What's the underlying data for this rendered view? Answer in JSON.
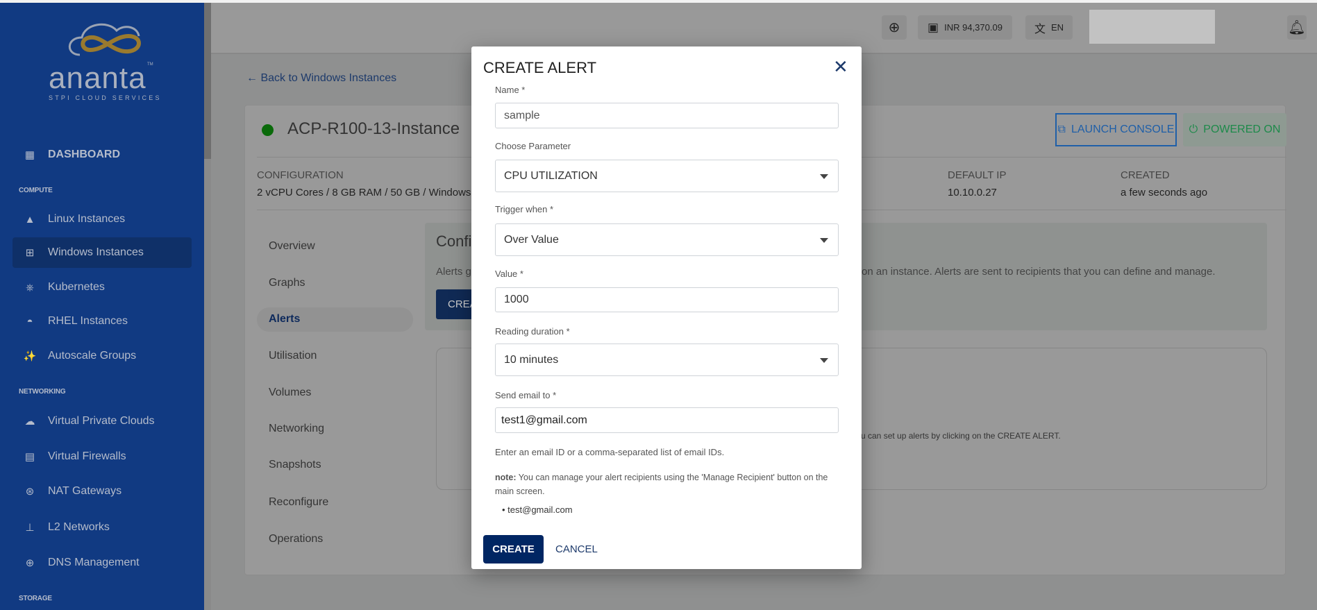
{
  "brand": {
    "name": "ananta",
    "tagline": "STPI CLOUD SERVICES",
    "tm": "TM",
    "colors": {
      "sidebar": "#113a82",
      "accent": "#002663",
      "gold": "#b8860b"
    }
  },
  "sidebar": {
    "dashboard": "DASHBOARD",
    "sections": {
      "compute": "COMPUTE",
      "networking": "NETWORKING",
      "storage": "STORAGE"
    },
    "items": [
      {
        "label": "Linux Instances",
        "icon": "linux-icon"
      },
      {
        "label": "Windows Instances",
        "icon": "windows-icon",
        "active": true
      },
      {
        "label": "Kubernetes",
        "icon": "kubernetes-icon"
      },
      {
        "label": "RHEL Instances",
        "icon": "redhat-icon"
      },
      {
        "label": "Autoscale Groups",
        "icon": "magic-wand-icon"
      },
      {
        "label": "Virtual Private Clouds",
        "icon": "cloud-lock-icon"
      },
      {
        "label": "Virtual Firewalls",
        "icon": "firewall-icon"
      },
      {
        "label": "NAT Gateways",
        "icon": "router-icon"
      },
      {
        "label": "L2 Networks",
        "icon": "network-icon"
      },
      {
        "label": "DNS Management",
        "icon": "globe-icon"
      }
    ]
  },
  "header": {
    "balance": "INR 94,370.09",
    "language": "EN"
  },
  "page": {
    "back_link": "Back to Windows Instances",
    "instance_name": "ACP-R100-13-Instance",
    "status_color": "#0a7a0a",
    "launch_console": "LAUNCH CONSOLE",
    "power_state": "POWERED ON",
    "config_label": "CONFIGURATION",
    "config_value": "2 vCPU Cores / 8 GB RAM / 50 GB / Windows S",
    "default_ip_label": "DEFAULT IP",
    "default_ip": "10.10.0.27",
    "created_label": "CREATED",
    "created": "a few seconds ago",
    "tabs": [
      "Overview",
      "Graphs",
      "Alerts",
      "Utilisation",
      "Volumes",
      "Networking",
      "Snapshots",
      "Reconfigure",
      "Operations"
    ],
    "active_tab": "Alerts",
    "info_title": "Confi",
    "info_text_left": "Alerts g",
    "info_text_right": "on an instance. Alerts are sent to recipients that you can define and manage.",
    "create_btn_partial": "CREA",
    "empty_text": "u can set up alerts by clicking on the CREATE ALERT."
  },
  "dialog": {
    "title": "CREATE ALERT",
    "name_label": "Name *",
    "name_value": "sample",
    "parameter_label": "Choose Parameter",
    "parameter_value": "CPU UTILIZATION",
    "trigger_label": "Trigger when *",
    "trigger_value": "Over Value",
    "value_label": "Value *",
    "value_value": "1000",
    "duration_label": "Reading duration *",
    "duration_value": "10 minutes",
    "email_label": "Send email to *",
    "email_value": "test1@gmail.com",
    "email_help": "Enter an email ID or a comma-separated list of email IDs.",
    "note_label": "note:",
    "note_text": " You can manage your alert recipients using the 'Manage Recipient' button on the main screen.",
    "recipients": [
      "test@gmail.com"
    ],
    "create": "CREATE",
    "cancel": "CANCEL"
  }
}
